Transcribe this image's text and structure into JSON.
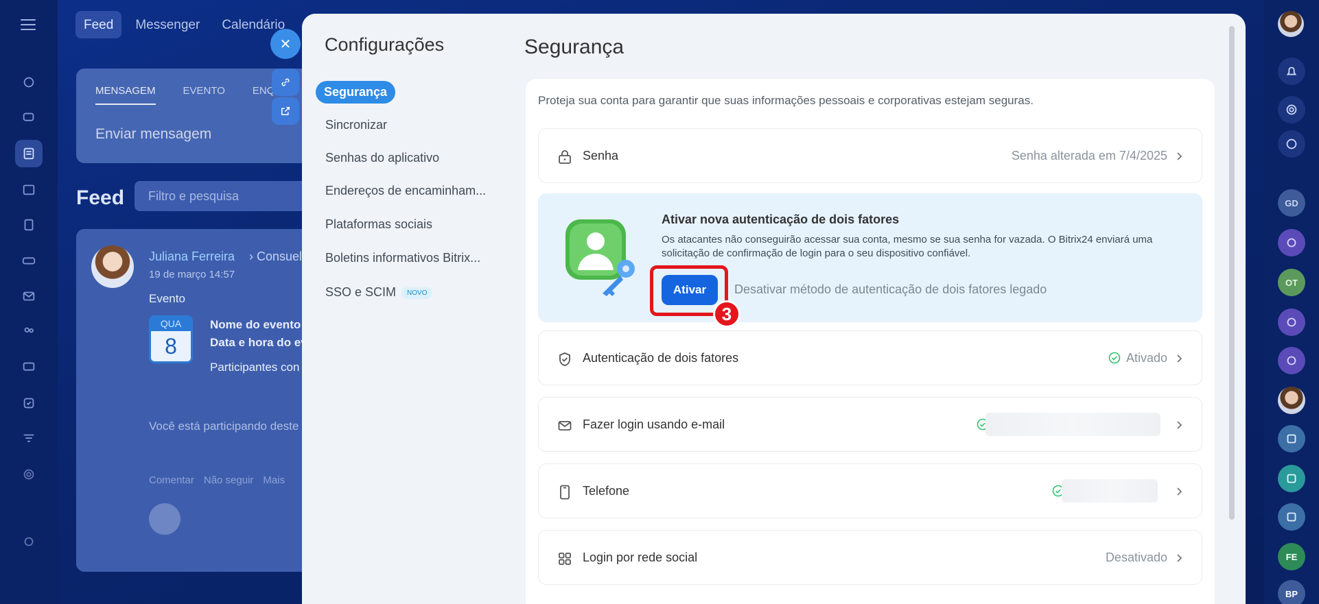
{
  "portal": {
    "topnav": [
      "Feed",
      "Messenger",
      "Calendário"
    ],
    "feed_tabs": [
      "MENSAGEM",
      "EVENTO",
      "ENQ"
    ],
    "send_placeholder": "Enviar mensagem",
    "feed_title": "Feed",
    "filter_placeholder": "Filtro e pesquisa",
    "post": {
      "author": "Juliana Ferreira",
      "author_more": "› Consuelo",
      "date": "19 de março 14:57",
      "type": "Evento",
      "cal_weekday": "QUA",
      "cal_day": "8",
      "line1": "Nome do evento",
      "line2": "Data e hora do ev",
      "line3": "Participantes con",
      "participating": "Você está participando deste",
      "actions": [
        "Comentar",
        "Não seguir",
        "Mais"
      ]
    },
    "right_rail": {
      "initials": [
        "GD",
        "OT",
        "FE",
        "BP"
      ]
    }
  },
  "settings": {
    "title": "Configurações",
    "nav": [
      {
        "label": "Segurança"
      },
      {
        "label": "Sincronizar"
      },
      {
        "label": "Senhas do aplicativo"
      },
      {
        "label": "Endereços de encaminham..."
      },
      {
        "label": "Plataformas sociais"
      },
      {
        "label": "Boletins informativos Bitrix..."
      },
      {
        "label": "SSO e SCIM",
        "badge": "NOVO"
      }
    ]
  },
  "security": {
    "title": "Segurança",
    "description": "Proteja sua conta para garantir que suas informações pessoais e corporativas estejam seguras.",
    "password": {
      "label": "Senha",
      "value": "Senha alterada em 7/4/2025"
    },
    "new2fa": {
      "title": "Ativar nova autenticação de dois fatores",
      "text": "Os atacantes não conseguirão acessar sua conta, mesmo se sua senha for vazada. O Bitrix24 enviará uma solicitação de confirmação de login para o seu dispositivo confiável.",
      "button": "Ativar",
      "step": "3",
      "disable_link": "Desativar método de autenticação de dois fatores legado"
    },
    "twofa_row": {
      "label": "Autenticação de dois fatores",
      "value": "Ativado"
    },
    "email_row": {
      "label": "Fazer login usando e-mail"
    },
    "phone_row": {
      "label": "Telefone"
    },
    "social_row": {
      "label": "Login por rede social",
      "value": "Desativado"
    }
  }
}
